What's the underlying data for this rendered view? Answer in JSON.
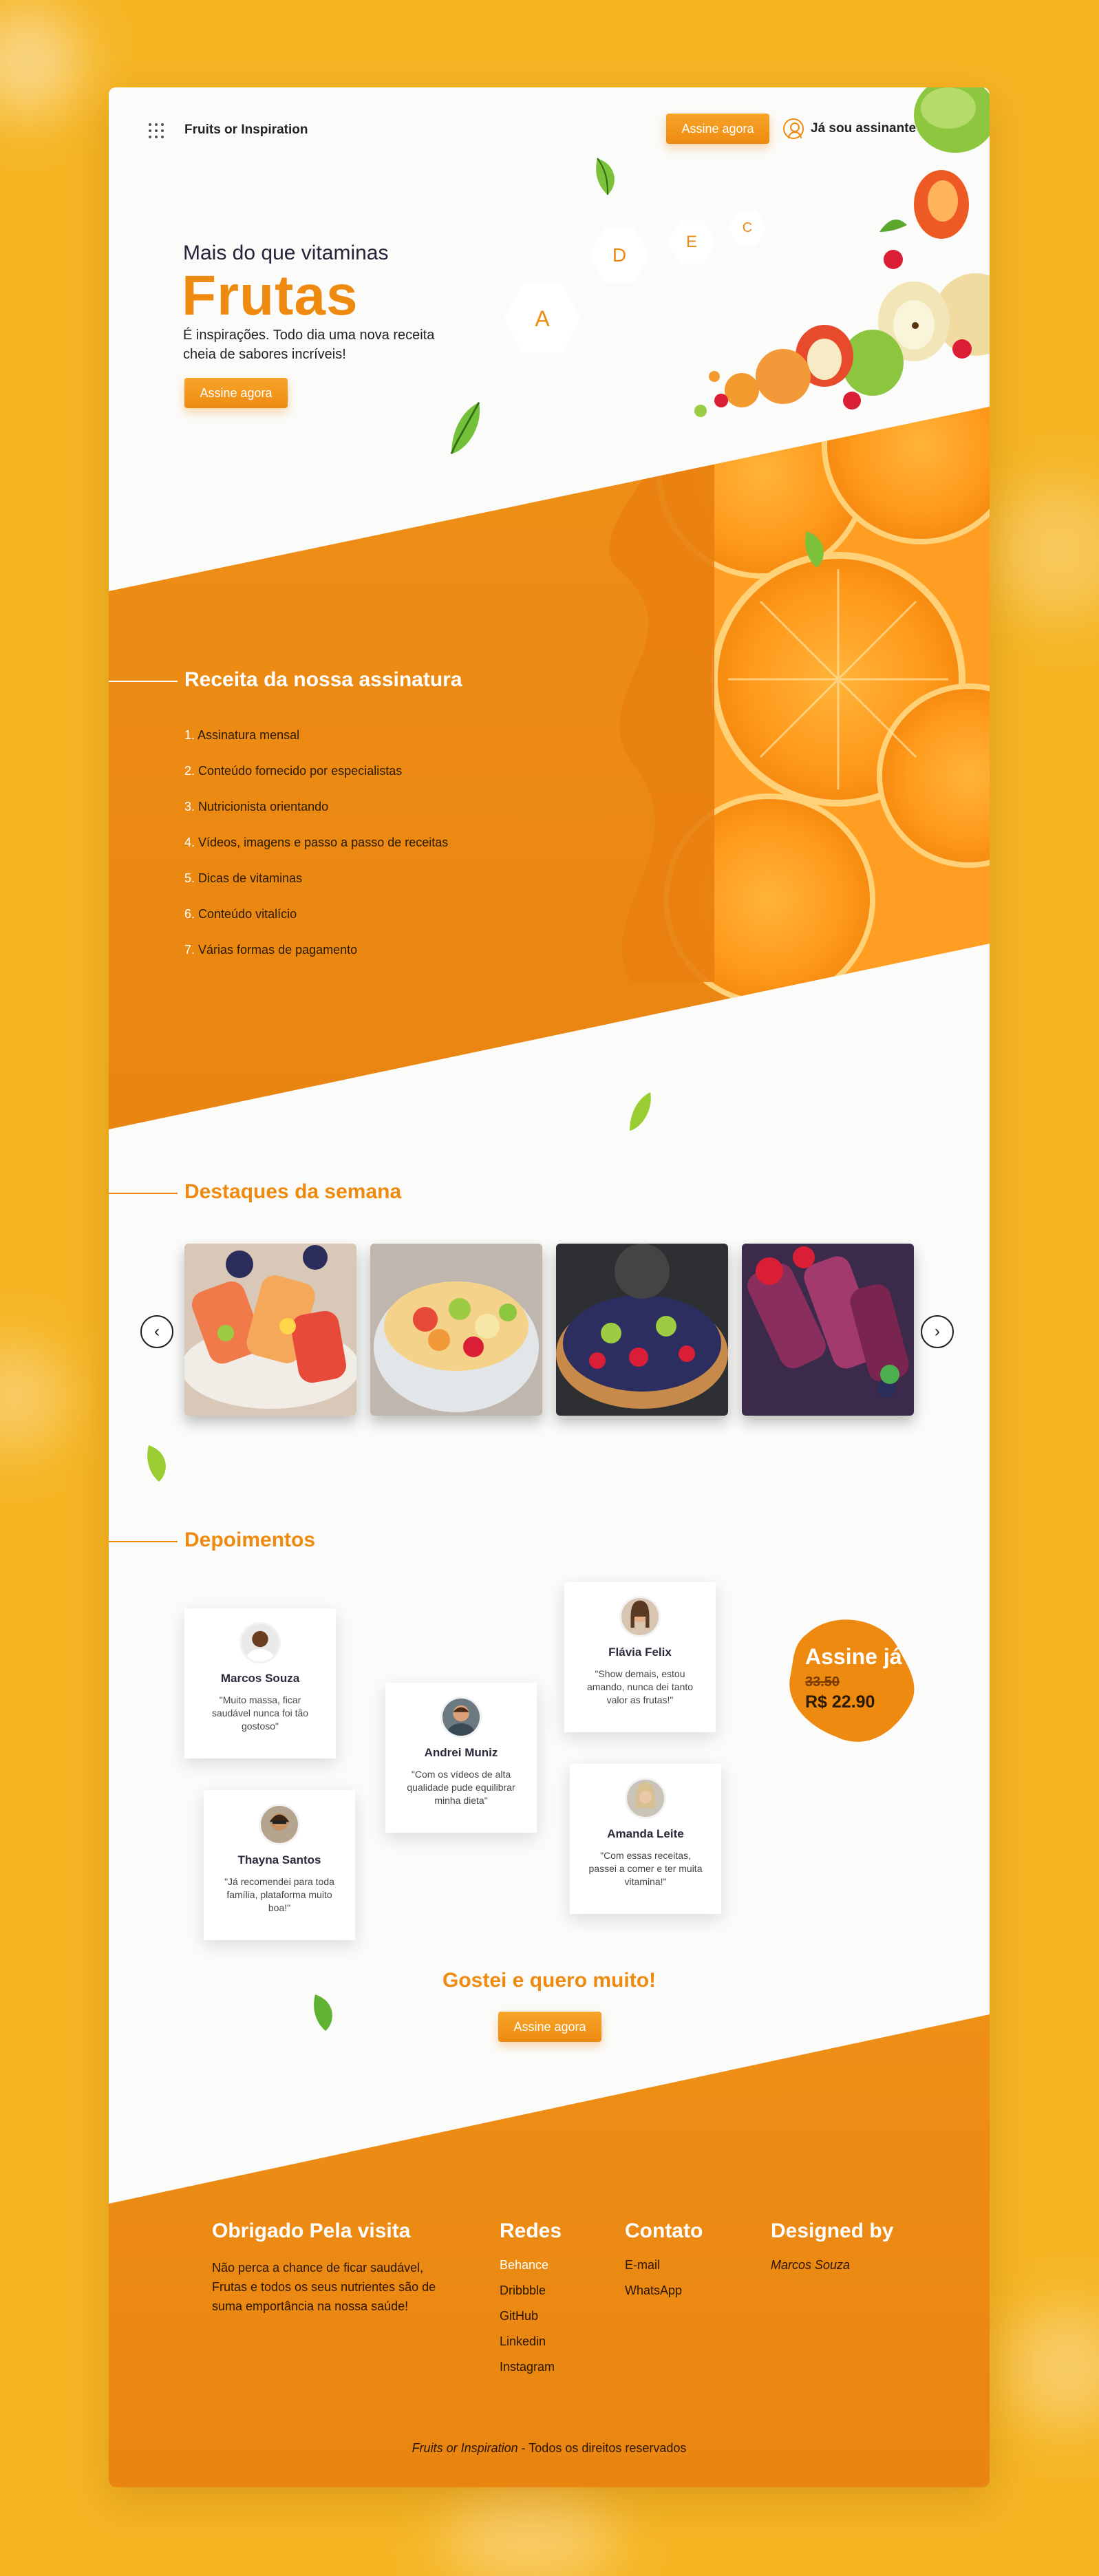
{
  "header": {
    "brand": "Fruits or Inspiration",
    "subscribe_label": "Assine agora",
    "login_label": "Já sou assinante"
  },
  "hero": {
    "subtitle": "Mais do que vitaminas",
    "title": "Frutas",
    "text": "É inspirações. Todo dia uma nova receita cheia de sabores incríveis!",
    "button_label": "Assine agora",
    "vitamins": [
      "A",
      "D",
      "E",
      "C"
    ]
  },
  "features": {
    "title": "Receita da nossa assinatura",
    "items": [
      {
        "num": "1.",
        "label": "Assinatura mensal"
      },
      {
        "num": "2.",
        "label": "Conteúdo fornecido por especialistas"
      },
      {
        "num": "3.",
        "label": "Nutricionista orientando"
      },
      {
        "num": "4.",
        "label": "Vídeos, imagens e passo a passo de receitas"
      },
      {
        "num": "5.",
        "label": "Dicas de vitaminas"
      },
      {
        "num": "6.",
        "label": "Conteúdo vitalício"
      },
      {
        "num": "7.",
        "label": "Várias formas de pagamento"
      }
    ]
  },
  "highlights": {
    "title": "Destaques da semana",
    "prev_icon": "chevron-left-icon",
    "next_icon": "chevron-right-icon"
  },
  "testimonials": {
    "title": "Depoimentos",
    "items": [
      {
        "name": "Marcos Souza",
        "text": "\"Muito massa, ficar saudável nunca foi tão gostoso\""
      },
      {
        "name": "Andrei Muniz",
        "text": "\"Com os vídeos de alta qualidade pude equilibrar minha dieta\""
      },
      {
        "name": "Thayna Santos",
        "text": "\"Já recomendei para toda família, plataforma muito boa!\""
      },
      {
        "name": "Flávia Felix",
        "text": "\"Show demais, estou amando, nunca dei tanto valor as frutas!\""
      },
      {
        "name": "Amanda Leite",
        "text": "\"Com essas receitas, passei a comer e ter muita vitamina!\""
      }
    ]
  },
  "offer": {
    "title": "Assine já",
    "old_price": "33.50",
    "price": "R$ 22.90"
  },
  "cta": {
    "title": "Gostei e quero muito!",
    "button_label": "Assine agora"
  },
  "footer": {
    "thanks_title": "Obrigado Pela visita",
    "thanks_text": "Não perca a chance de ficar saudável, Frutas e todos os seus nutrientes são de suma emportância na nossa saúde!",
    "social_title": "Redes",
    "social": [
      "Behance",
      "Dribbble",
      "GitHub",
      "Linkedin",
      "Instagram"
    ],
    "contact_title": "Contato",
    "contact": [
      "E-mail",
      "WhatsApp"
    ],
    "designed_title": "Designed by",
    "designer": "Marcos Souza",
    "copyright_brand": "Fruits or Inspiration",
    "copyright_text": " - Todos os direitos reservados"
  },
  "colors": {
    "accent": "#EE8A10",
    "background": "#F5B523",
    "card": "#FBFBF9"
  }
}
